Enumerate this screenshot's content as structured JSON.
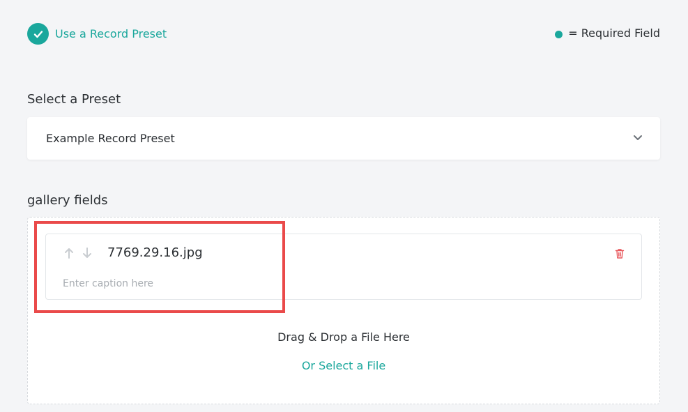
{
  "header": {
    "preset_toggle_label": "Use a Record Preset",
    "required_legend": "= Required Field"
  },
  "preset": {
    "section_label": "Select a Preset",
    "selected_value": "Example Record Preset"
  },
  "gallery": {
    "section_label": "gallery fields",
    "files": [
      {
        "name": "7769.29.16.jpg",
        "caption_placeholder": "Enter caption here",
        "caption_value": ""
      }
    ],
    "drop_text": "Drag & Drop a File Here",
    "select_file_label": "Or Select a File"
  },
  "colors": {
    "accent": "#1aa79c",
    "delete": "#e8565b",
    "highlight": "#ea4a4a",
    "background": "#f4f5f7"
  },
  "icons": [
    "check-icon",
    "required-dot-icon",
    "chevron-down-icon",
    "arrow-up-icon",
    "arrow-down-icon",
    "trash-icon"
  ]
}
